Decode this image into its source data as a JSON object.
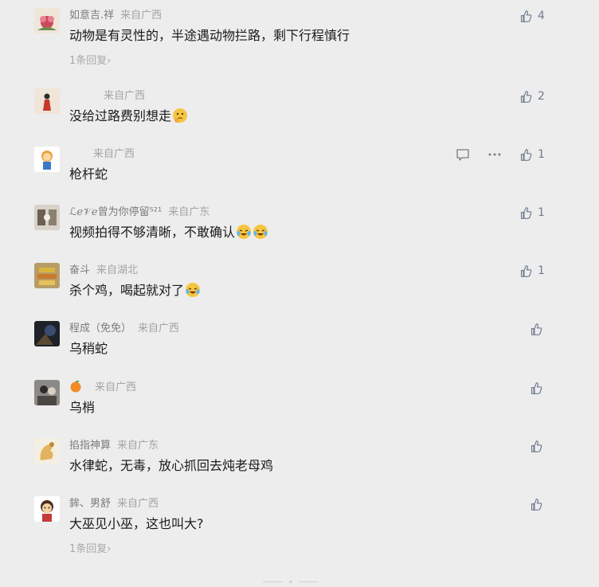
{
  "comments": [
    {
      "name": "如意吉.祥",
      "location": "来自广西",
      "text": "动物是有灵性的，半途遇动物拦路，剩下行程慎行",
      "likes": "4",
      "replies": "1条回复",
      "avatar": "flower-avatar"
    },
    {
      "name": "",
      "location": "来自广西",
      "text": "没给过路费别想走",
      "likes": "2",
      "replies": "",
      "avatar": "figure-avatar",
      "emoji": "thinking-emoji"
    },
    {
      "name": "",
      "location": "来自广西",
      "text": "枪杆蛇",
      "likes": "1",
      "replies": "",
      "avatar": "cartoon-avatar"
    },
    {
      "name": "ℒℯ𝒱ℯ曾为你停留⁵²¹",
      "location": "来自广东",
      "text": "视频拍得不够清晰，不敢确认",
      "likes": "1",
      "replies": "",
      "avatar": "photo-avatar",
      "emoji": "laughing-crying-emoji",
      "emoji_count": 2
    },
    {
      "name": "奋斗",
      "location": "来自湖北",
      "text": "杀个鸡，喝起就对了",
      "likes": "1",
      "replies": "",
      "avatar": "objects-avatar",
      "emoji": "laughing-crying-emoji",
      "emoji_count": 1
    },
    {
      "name": "程成（免免）",
      "location": "来自广西",
      "text": "乌稍蛇",
      "likes": "",
      "replies": "",
      "avatar": "dark-photo-avatar"
    },
    {
      "name": "",
      "location": "来自广西",
      "text": "乌梢",
      "likes": "",
      "replies": "",
      "avatar": "people-avatar",
      "name_emoji": "tangerine-emoji"
    },
    {
      "name": "掐指神算",
      "location": "来自广东",
      "text": "水律蛇，无毒，放心抓回去炖老母鸡",
      "likes": "",
      "replies": "",
      "avatar": "hand-avatar"
    },
    {
      "name": "鉾、男舒",
      "location": "来自广西",
      "text": "大巫见小巫，这也叫大?",
      "likes": "",
      "replies": "1条回复",
      "avatar": "cartoon-boy-avatar"
    }
  ],
  "icons": {
    "like": "thumbs-up-icon",
    "comment": "comment-icon",
    "more": "more-icon",
    "chevron": "chevron-right-icon"
  },
  "colors": {
    "background": "#ededed",
    "text": "#1a1a1a",
    "meta": "#a3a3a3",
    "like": "#6f7c8f"
  }
}
